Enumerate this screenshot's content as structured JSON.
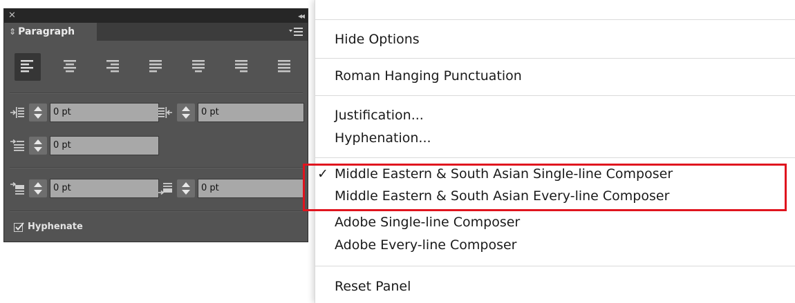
{
  "panel": {
    "close_glyph": "✕",
    "collapse_glyph": "◂◂",
    "tab_updown_glyph": "⇕",
    "tab_label": "Paragraph",
    "align_buttons": [
      {
        "name": "align-left",
        "icon": "align-left-icon",
        "active": true
      },
      {
        "name": "align-center",
        "icon": "align-center-icon",
        "active": false
      },
      {
        "name": "align-right",
        "icon": "align-right-icon",
        "active": false
      },
      {
        "name": "justify-last-left",
        "icon": "justify-left-icon",
        "active": false
      },
      {
        "name": "justify-last-center",
        "icon": "justify-center-icon",
        "active": false
      },
      {
        "name": "justify-last-right",
        "icon": "justify-right-icon",
        "active": false
      },
      {
        "name": "justify-all",
        "icon": "justify-all-icon",
        "active": false
      }
    ],
    "fields": {
      "left_indent": "0 pt",
      "right_indent": "0 pt",
      "first_line_indent": "0 pt",
      "space_before": "0 pt",
      "space_after": "0 pt"
    },
    "hyphenate_label": "Hyphenate",
    "hyphenate_checked": true,
    "colors": {
      "panel_bg": "#535353",
      "titlebar_bg": "#262626",
      "field_bg": "#a8a8a8"
    }
  },
  "menu": {
    "hide_options": "Hide Options",
    "roman_hanging": "Roman Hanging Punctuation",
    "justification": "Justification...",
    "hyphenation": "Hyphenation...",
    "checkmark": "✓",
    "me_single_line": "Middle Eastern & South Asian Single-line Composer",
    "me_every_line": "Middle Eastern & South Asian Every-line Composer",
    "adobe_single_line": "Adobe Single-line Composer",
    "adobe_every_line": "Adobe Every-line Composer",
    "reset_panel": "Reset Panel",
    "highlight_color": "#e0141e"
  }
}
